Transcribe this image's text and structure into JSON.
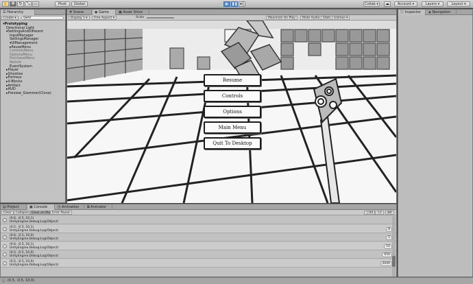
{
  "toolbar": {
    "pivot": "Pivot",
    "global": "Global",
    "collab": "Collab ▾",
    "account": "Account ▾",
    "layers": "Layers ▾",
    "layout": "Layout ▾"
  },
  "hierarchy": {
    "tab": "Hierarchy",
    "create": "Create ▾",
    "search_placeholder": "Q▾All",
    "items": [
      {
        "label": "Prototyping",
        "indent": 0,
        "dim": false
      },
      {
        "label": "Directional Light",
        "indent": 1,
        "dim": false
      },
      {
        "label": "SettingsAndUIParent",
        "indent": 1,
        "dim": false
      },
      {
        "label": "InputManager",
        "indent": 2,
        "dim": false
      },
      {
        "label": "SettingsManager",
        "indent": 2,
        "dim": false
      },
      {
        "label": "UIManagement",
        "indent": 2,
        "dim": false
      },
      {
        "label": "PauseMenu",
        "indent": 2,
        "dim": false
      },
      {
        "label": "ControlsMenu",
        "indent": 2,
        "dim": true
      },
      {
        "label": "OptionsMenu",
        "indent": 2,
        "dim": true
      },
      {
        "label": "PurchaseMenu",
        "indent": 2,
        "dim": true
      },
      {
        "label": "Reticle",
        "indent": 2,
        "dim": true
      },
      {
        "label": "EventSystem",
        "indent": 2,
        "dim": false
      },
      {
        "label": "Player",
        "indent": 1,
        "dim": false
      },
      {
        "label": "Ghosties",
        "indent": 1,
        "dim": false
      },
      {
        "label": "Fortress",
        "indent": 1,
        "dim": false
      },
      {
        "label": "X-Blocks",
        "indent": 1,
        "dim": false
      },
      {
        "label": "Artifact",
        "indent": 1,
        "dim": false
      },
      {
        "label": "HUD",
        "indent": 1,
        "dim": false
      },
      {
        "label": "Preview_Glammer(Clone)",
        "indent": 1,
        "dim": false
      }
    ]
  },
  "game": {
    "tabs": [
      "Scene",
      "Game",
      "Asset Store"
    ],
    "display": "Display 1 ▾",
    "aspect": "Free Aspect ▾",
    "scale": "Scale",
    "options": [
      "Maximize On Play",
      "Mute Audio",
      "Stats",
      "Gizmos ▾"
    ],
    "menu": [
      "Resume",
      "Controls",
      "Options",
      "Main Menu",
      "Quit To Desktop"
    ]
  },
  "inspector": {
    "tabs": [
      "Inspector",
      "Navigation"
    ]
  },
  "console": {
    "tabs": [
      "Project",
      "Console",
      "Animation",
      "Animator"
    ],
    "buttons": [
      "Clear",
      "Collapse",
      "Clear on Play",
      "Error Pause"
    ],
    "counts": [
      "44",
      "1",
      "0"
    ],
    "rows": [
      {
        "line1": "(0.6, -0.5, 10.1)",
        "line2": "UnityEngine.Debug:Log(Object)",
        "count": ""
      },
      {
        "line1": "(0.5, -0.5, 10.1)",
        "line2": "UnityEngine.Debug:Log(Object)",
        "count": "8"
      },
      {
        "line1": "(0.6, -0.5, 10.0)",
        "line2": "UnityEngine.Debug:Log(Object)",
        "count": "5"
      },
      {
        "line1": "(0.6, -0.5, 10.1)",
        "line2": "UnityEngine.Debug:Log(Object)",
        "count": "10"
      },
      {
        "line1": "(0.5, -0.5, 10.0)",
        "line2": "UnityEngine.Debug:Log(Object)",
        "count": "656"
      },
      {
        "line1": "(0.5, -0.5, 10.0)",
        "line2": "UnityEngine.Debug:Log(Object)",
        "count": "2040"
      }
    ]
  },
  "status": "(0.5, -0.5, 10.0)"
}
